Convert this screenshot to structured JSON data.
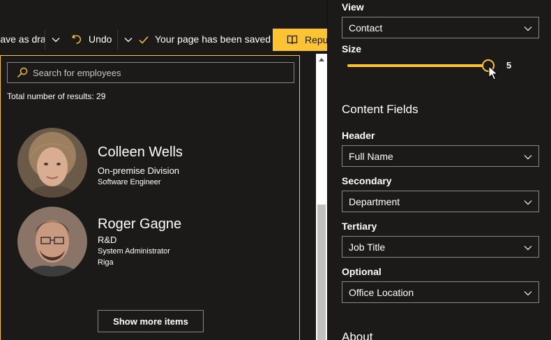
{
  "toolbar": {
    "save_draft_label": "Save as draft",
    "undo_label": "Undo",
    "saved_status": "Your page has been saved",
    "republish_label": "Republish"
  },
  "webpart": {
    "search": {
      "placeholder": "Search for employees"
    },
    "total_results": "Total number of results: 29",
    "people": [
      {
        "name": "Colleen Wells",
        "department": "On-premise Division",
        "job_title": "Software Engineer"
      },
      {
        "name": "Roger Gagne",
        "department": "R&D",
        "job_title": "System Administrator",
        "office": "Riga"
      }
    ],
    "show_more_label": "Show more items"
  },
  "pane": {
    "view_label": "View",
    "view_value": "Contact",
    "size_label": "Size",
    "size_value": "5",
    "content_fields_title": "Content Fields",
    "fields": [
      {
        "label": "Header",
        "value": "Full Name"
      },
      {
        "label": "Secondary",
        "value": "Department"
      },
      {
        "label": "Tertiary",
        "value": "Job Title"
      },
      {
        "label": "Optional",
        "value": "Office Location"
      }
    ],
    "about_title": "About"
  },
  "colors": {
    "accent": "#fcc335",
    "background": "#1b1a19",
    "border": "#8a8886"
  },
  "icons": [
    "chevron-down-icon",
    "undo-icon",
    "checkmark-icon",
    "book-icon",
    "search-icon",
    "cursor-icon"
  ]
}
